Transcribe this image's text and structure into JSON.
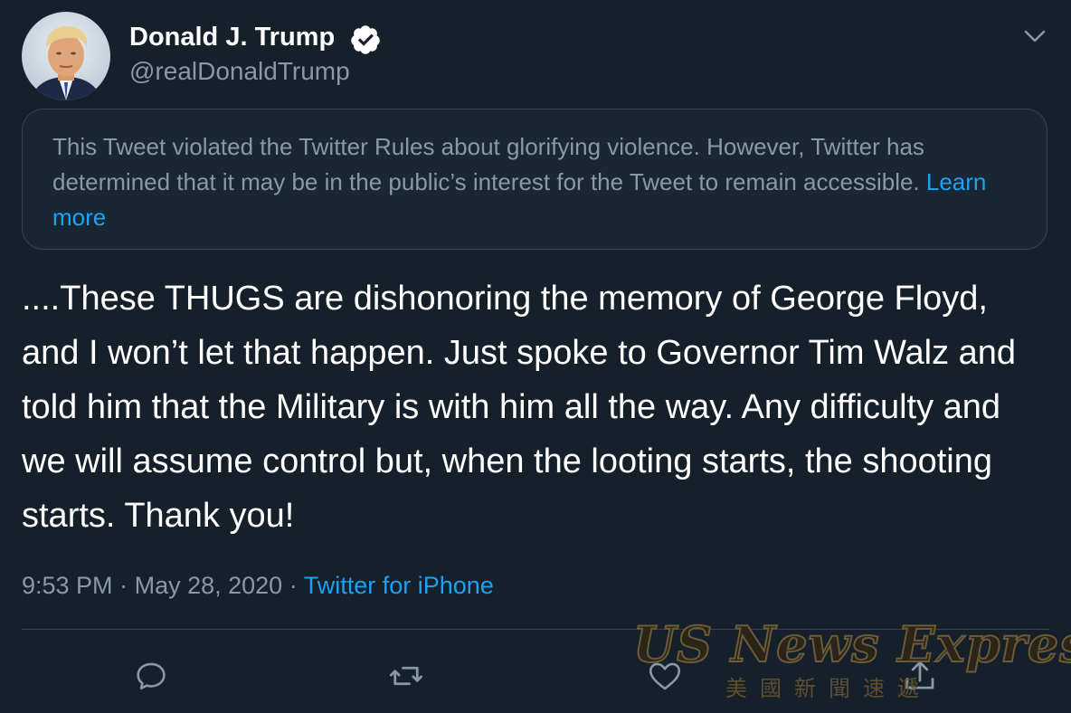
{
  "tweet": {
    "author": {
      "display_name": "Donald J. Trump",
      "handle": "@realDonaldTrump",
      "verified": true,
      "verified_icon": "verified-badge-icon",
      "avatar": "profile-photo"
    },
    "notice": {
      "text": "This Tweet violated the Twitter Rules about glorifying violence. However, Twitter has determined that it may be in the public’s interest for the Tweet to remain accessible. ",
      "link": "Learn more"
    },
    "body": "....These THUGS are dishonoring the memory of George Floyd, and I won’t let that happen. Just spoke to Governor Tim Walz and told him that the Military is with him all the way. Any difficulty and we will assume control but, when the looting starts, the shooting starts. Thank you!",
    "time": "9:53 PM",
    "date": "May 28, 2020",
    "separator": "·",
    "source": "Twitter for iPhone",
    "actions": [
      {
        "name": "reply",
        "icon": "reply-icon"
      },
      {
        "name": "retweet",
        "icon": "retweet-icon"
      },
      {
        "name": "like",
        "icon": "heart-icon"
      },
      {
        "name": "share",
        "icon": "share-icon"
      }
    ]
  },
  "watermark": {
    "title": "US News Express",
    "subtitle": "美國新聞速遞"
  },
  "colors": {
    "background": "#15202b",
    "secondary_text": "#8899a6",
    "link": "#1da1f2",
    "border": "#38444d"
  }
}
